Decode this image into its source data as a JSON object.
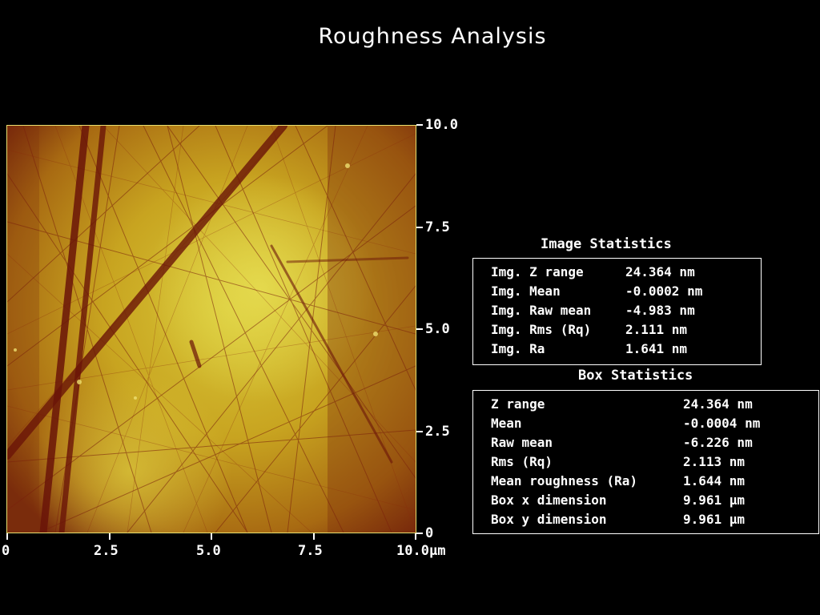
{
  "title": "Roughness Analysis",
  "image_axes": {
    "y_ticks": [
      "10.0",
      "7.5",
      "5.0",
      "2.5",
      "0"
    ],
    "x_ticks": [
      "0",
      "2.5",
      "5.0",
      "7.5",
      "10.0"
    ],
    "x_unit": "µm"
  },
  "image_statistics": {
    "title": "Image Statistics",
    "rows": [
      {
        "label": "Img. Z range",
        "value": "24.364 nm"
      },
      {
        "label": "Img. Mean",
        "value": "-0.0002 nm"
      },
      {
        "label": "Img. Raw mean",
        "value": "-4.983 nm"
      },
      {
        "label": "Img. Rms (Rq)",
        "value": "2.111 nm"
      },
      {
        "label": "Img. Ra",
        "value": "1.641 nm"
      }
    ]
  },
  "box_statistics": {
    "title": "Box Statistics",
    "rows": [
      {
        "label": "Z range",
        "value": "24.364 nm"
      },
      {
        "label": "Mean",
        "value": "-0.0004 nm"
      },
      {
        "label": "Raw mean",
        "value": "-6.226 nm"
      },
      {
        "label": "Rms (Rq)",
        "value": "2.113 nm"
      },
      {
        "label": "Mean roughness (Ra)",
        "value": "1.644 nm"
      },
      {
        "label": "Box x dimension",
        "value": "9.961 µm"
      },
      {
        "label": "Box y dimension",
        "value": "9.961 µm"
      }
    ]
  },
  "colors": {
    "surface_light": "#e0d040",
    "surface_mid": "#c08a10",
    "surface_dark": "#6a1a0a",
    "image_border": "#e8e070"
  }
}
